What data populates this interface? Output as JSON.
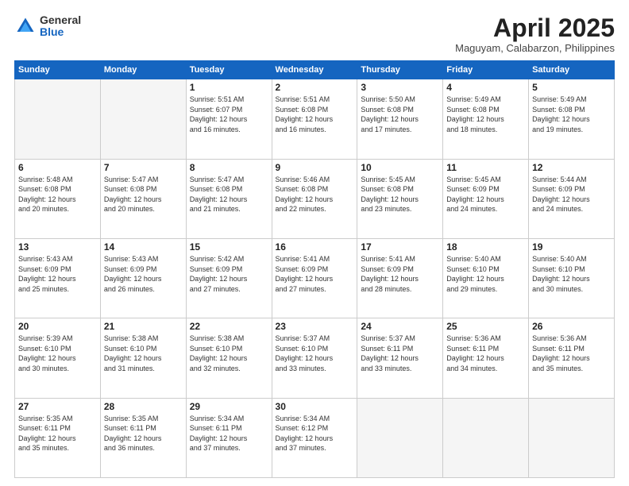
{
  "header": {
    "logo_general": "General",
    "logo_blue": "Blue",
    "month_title": "April 2025",
    "location": "Maguyam, Calabarzon, Philippines"
  },
  "days_of_week": [
    "Sunday",
    "Monday",
    "Tuesday",
    "Wednesday",
    "Thursday",
    "Friday",
    "Saturday"
  ],
  "weeks": [
    [
      {
        "day": "",
        "info": ""
      },
      {
        "day": "",
        "info": ""
      },
      {
        "day": "1",
        "info": "Sunrise: 5:51 AM\nSunset: 6:07 PM\nDaylight: 12 hours\nand 16 minutes."
      },
      {
        "day": "2",
        "info": "Sunrise: 5:51 AM\nSunset: 6:08 PM\nDaylight: 12 hours\nand 16 minutes."
      },
      {
        "day": "3",
        "info": "Sunrise: 5:50 AM\nSunset: 6:08 PM\nDaylight: 12 hours\nand 17 minutes."
      },
      {
        "day": "4",
        "info": "Sunrise: 5:49 AM\nSunset: 6:08 PM\nDaylight: 12 hours\nand 18 minutes."
      },
      {
        "day": "5",
        "info": "Sunrise: 5:49 AM\nSunset: 6:08 PM\nDaylight: 12 hours\nand 19 minutes."
      }
    ],
    [
      {
        "day": "6",
        "info": "Sunrise: 5:48 AM\nSunset: 6:08 PM\nDaylight: 12 hours\nand 20 minutes."
      },
      {
        "day": "7",
        "info": "Sunrise: 5:47 AM\nSunset: 6:08 PM\nDaylight: 12 hours\nand 20 minutes."
      },
      {
        "day": "8",
        "info": "Sunrise: 5:47 AM\nSunset: 6:08 PM\nDaylight: 12 hours\nand 21 minutes."
      },
      {
        "day": "9",
        "info": "Sunrise: 5:46 AM\nSunset: 6:08 PM\nDaylight: 12 hours\nand 22 minutes."
      },
      {
        "day": "10",
        "info": "Sunrise: 5:45 AM\nSunset: 6:08 PM\nDaylight: 12 hours\nand 23 minutes."
      },
      {
        "day": "11",
        "info": "Sunrise: 5:45 AM\nSunset: 6:09 PM\nDaylight: 12 hours\nand 24 minutes."
      },
      {
        "day": "12",
        "info": "Sunrise: 5:44 AM\nSunset: 6:09 PM\nDaylight: 12 hours\nand 24 minutes."
      }
    ],
    [
      {
        "day": "13",
        "info": "Sunrise: 5:43 AM\nSunset: 6:09 PM\nDaylight: 12 hours\nand 25 minutes."
      },
      {
        "day": "14",
        "info": "Sunrise: 5:43 AM\nSunset: 6:09 PM\nDaylight: 12 hours\nand 26 minutes."
      },
      {
        "day": "15",
        "info": "Sunrise: 5:42 AM\nSunset: 6:09 PM\nDaylight: 12 hours\nand 27 minutes."
      },
      {
        "day": "16",
        "info": "Sunrise: 5:41 AM\nSunset: 6:09 PM\nDaylight: 12 hours\nand 27 minutes."
      },
      {
        "day": "17",
        "info": "Sunrise: 5:41 AM\nSunset: 6:09 PM\nDaylight: 12 hours\nand 28 minutes."
      },
      {
        "day": "18",
        "info": "Sunrise: 5:40 AM\nSunset: 6:10 PM\nDaylight: 12 hours\nand 29 minutes."
      },
      {
        "day": "19",
        "info": "Sunrise: 5:40 AM\nSunset: 6:10 PM\nDaylight: 12 hours\nand 30 minutes."
      }
    ],
    [
      {
        "day": "20",
        "info": "Sunrise: 5:39 AM\nSunset: 6:10 PM\nDaylight: 12 hours\nand 30 minutes."
      },
      {
        "day": "21",
        "info": "Sunrise: 5:38 AM\nSunset: 6:10 PM\nDaylight: 12 hours\nand 31 minutes."
      },
      {
        "day": "22",
        "info": "Sunrise: 5:38 AM\nSunset: 6:10 PM\nDaylight: 12 hours\nand 32 minutes."
      },
      {
        "day": "23",
        "info": "Sunrise: 5:37 AM\nSunset: 6:10 PM\nDaylight: 12 hours\nand 33 minutes."
      },
      {
        "day": "24",
        "info": "Sunrise: 5:37 AM\nSunset: 6:11 PM\nDaylight: 12 hours\nand 33 minutes."
      },
      {
        "day": "25",
        "info": "Sunrise: 5:36 AM\nSunset: 6:11 PM\nDaylight: 12 hours\nand 34 minutes."
      },
      {
        "day": "26",
        "info": "Sunrise: 5:36 AM\nSunset: 6:11 PM\nDaylight: 12 hours\nand 35 minutes."
      }
    ],
    [
      {
        "day": "27",
        "info": "Sunrise: 5:35 AM\nSunset: 6:11 PM\nDaylight: 12 hours\nand 35 minutes."
      },
      {
        "day": "28",
        "info": "Sunrise: 5:35 AM\nSunset: 6:11 PM\nDaylight: 12 hours\nand 36 minutes."
      },
      {
        "day": "29",
        "info": "Sunrise: 5:34 AM\nSunset: 6:11 PM\nDaylight: 12 hours\nand 37 minutes."
      },
      {
        "day": "30",
        "info": "Sunrise: 5:34 AM\nSunset: 6:12 PM\nDaylight: 12 hours\nand 37 minutes."
      },
      {
        "day": "",
        "info": ""
      },
      {
        "day": "",
        "info": ""
      },
      {
        "day": "",
        "info": ""
      }
    ]
  ]
}
